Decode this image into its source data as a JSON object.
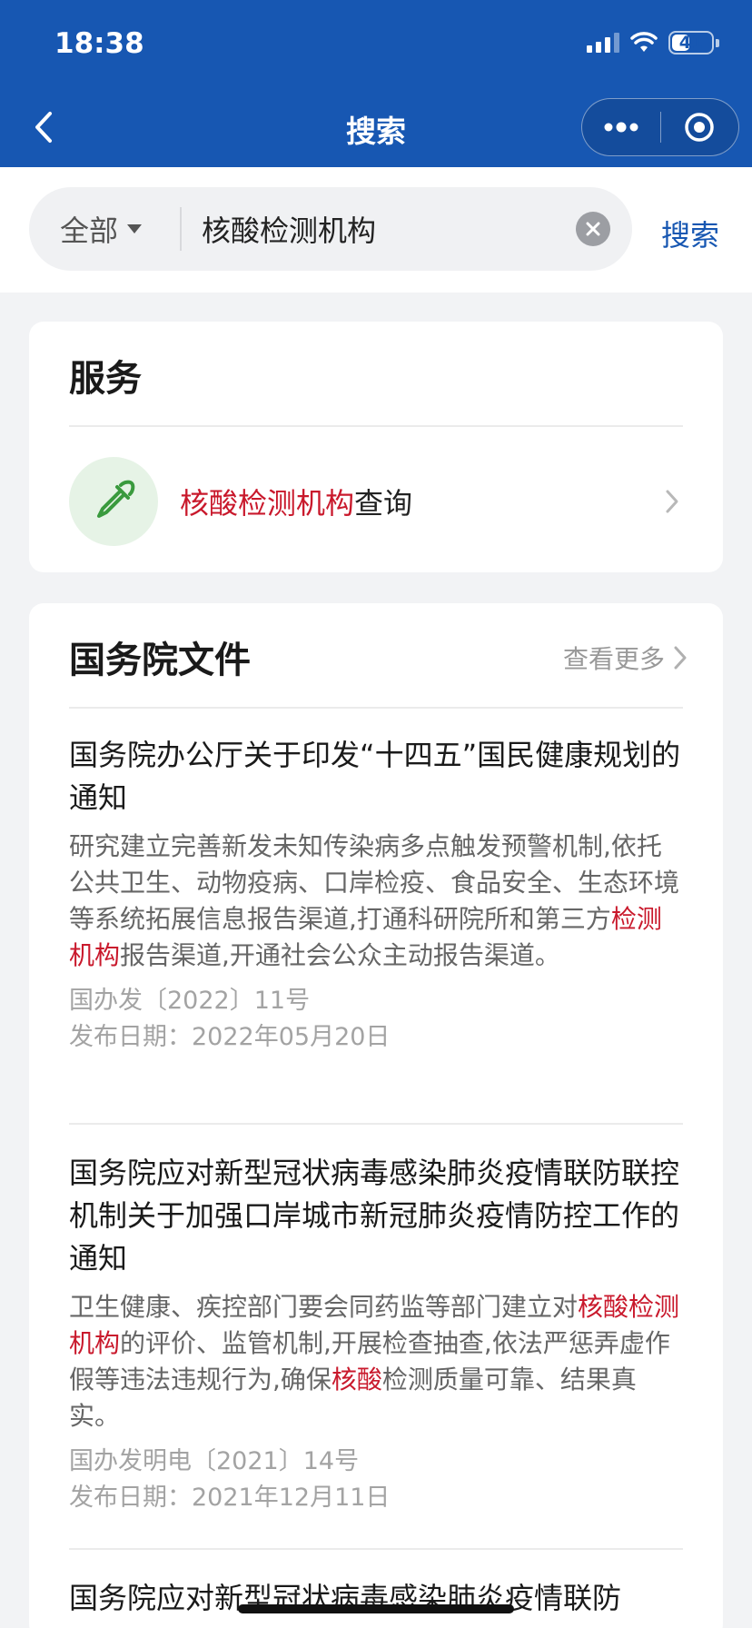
{
  "status_bar": {
    "time": "18:38",
    "battery": "41"
  },
  "header": {
    "title": "搜索"
  },
  "search": {
    "scope": "全部",
    "query": "核酸检测机构",
    "submit_label": "搜索"
  },
  "services": {
    "title": "服务",
    "item": {
      "highlight": "核酸检测机构",
      "rest": "查询"
    }
  },
  "docs": {
    "title": "国务院文件",
    "more_label": "查看更多",
    "items": [
      {
        "title": "国务院办公厅关于印发“十四五”国民健康规划的通知",
        "snippet": [
          {
            "t": "研究建立完善新发未知传染病多点触发预警机制,依托公共卫生、动物疫病、口岸检疫、食品安全、生态环境等系统拓展信息报告渠道,打通科研院所和第三方",
            "h": false
          },
          {
            "t": "检测机构",
            "h": true
          },
          {
            "t": "报告渠道,开通社会公众主动报告渠道。",
            "h": false
          }
        ],
        "doc_no": "国办发〔2022〕11号",
        "date": "发布日期：2022年05月20日"
      },
      {
        "title": "国务院应对新型冠状病毒感染肺炎疫情联防联控机制关于加强口岸城市新冠肺炎疫情防控工作的通知",
        "snippet": [
          {
            "t": "卫生健康、疾控部门要会同药监等部门建立对",
            "h": false
          },
          {
            "t": "核酸检测机构",
            "h": true
          },
          {
            "t": "的评价、监管机制,开展检查抽查,依法严惩弄虚作假等违法违规行为,确保",
            "h": false
          },
          {
            "t": "核酸",
            "h": true
          },
          {
            "t": "检测质量可靠、结果真实。",
            "h": false
          }
        ],
        "doc_no": "国办发明电〔2021〕14号",
        "date": "发布日期：2021年12月11日"
      },
      {
        "title": "国务院应对新型冠状病毒感染肺炎疫情联防"
      }
    ]
  },
  "colors": {
    "brand_blue": "#1757b2",
    "highlight_red": "#c9192c",
    "service_green": "#3a9a3e"
  },
  "icons": [
    "back-chevron-icon",
    "more-dots-icon",
    "target-icon",
    "dropdown-caret-icon",
    "clear-icon",
    "dropper-icon",
    "chevron-right-icon"
  ]
}
